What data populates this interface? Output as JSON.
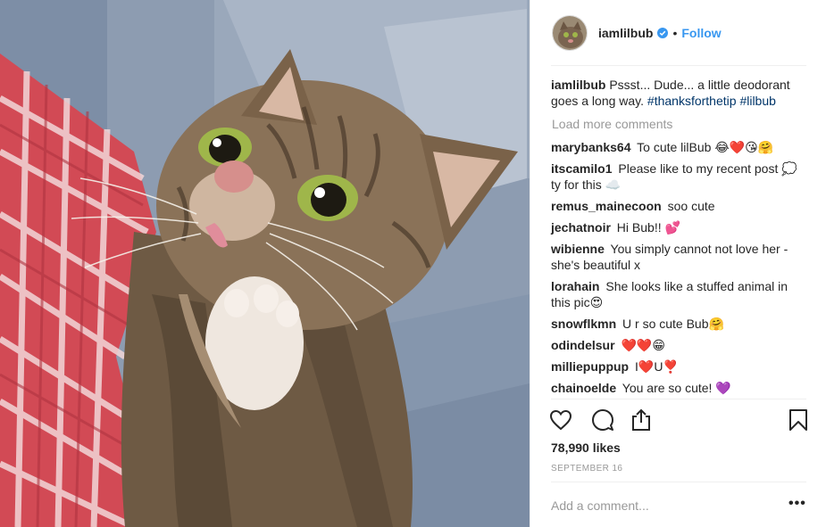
{
  "post": {
    "username": "iamlilbub",
    "follow_label": "Follow",
    "dot": "•",
    "caption": {
      "username": "iamlilbub",
      "text": "Pssst... Dude... a little deodorant goes a long way.",
      "hashtags": [
        "#thanksforthetip",
        "#lilbub"
      ]
    },
    "load_more": "Load more comments",
    "comments": [
      {
        "user": "marybanks64",
        "text": "To cute lilBub 😂❤️😘🤗"
      },
      {
        "user": "itscamilo1",
        "text": "Please like to my recent post 💭 ty for this ☁️"
      },
      {
        "user": "remus_mainecoon",
        "text": "soo cute"
      },
      {
        "user": "jechatnoir",
        "text": "Hi Bub!! 💕"
      },
      {
        "user": "wibienne",
        "text": "You simply cannot not love her - she's beautiful x"
      },
      {
        "user": "lorahain",
        "text": "She looks like a stuffed animal in this pic😍"
      },
      {
        "user": "snowflkmn",
        "text": "U r so cute Bub🤗"
      },
      {
        "user": "odindelsur",
        "text": "❤️❤️😁"
      },
      {
        "user": "milliepuppup",
        "text": "I❤️U❣️"
      },
      {
        "user": "chainoelde",
        "text": "You are so cute! 💜"
      }
    ],
    "likes": "78,990 likes",
    "date": "SEPTEMBER 16",
    "add_comment_placeholder": "Add a comment...",
    "more_options": "•••"
  },
  "colors": {
    "link": "#3897f0",
    "hashtag": "#003569",
    "muted": "#999999",
    "text": "#262626"
  },
  "icons": [
    "verified-badge-icon",
    "heart-icon",
    "comment-icon",
    "share-icon",
    "bookmark-icon",
    "more-options-icon"
  ]
}
